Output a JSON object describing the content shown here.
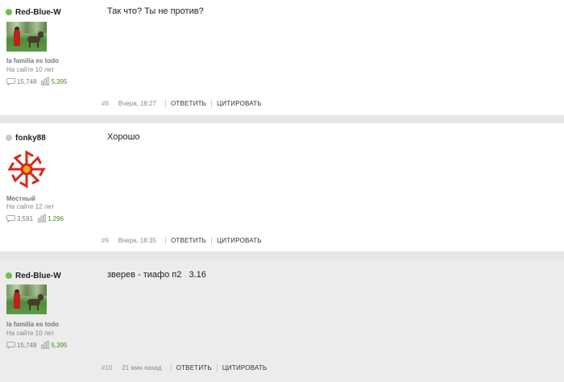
{
  "posts": [
    {
      "author": "Red-Blue-W",
      "online": true,
      "status": "la familia es todo",
      "since": "На сайте 10 лет",
      "post_count": "15,748",
      "reputation": "5,395",
      "message": "Так что? Ты не против?",
      "number": "#8",
      "time": "Вчера, 18:27",
      "reply_label": "ОТВЕТИТЬ",
      "quote_label": "ЦИТИРОВАТЬ"
    },
    {
      "author": "fonky88",
      "online": false,
      "status": "Местный",
      "since": "На сайте 12 лет",
      "post_count": "3,591",
      "reputation": "1,296",
      "message": "Хорошо",
      "number": "#9",
      "time": "Вчера, 18:35",
      "reply_label": "ОТВЕТИТЬ",
      "quote_label": "ЦИТИРОВАТЬ"
    },
    {
      "author": "Red-Blue-W",
      "online": true,
      "status": "la familia es todo",
      "since": "На сайте 10 лет",
      "post_count": "15,748",
      "reputation": "5,395",
      "message": "зверев - тиафо п2   3.16",
      "number": "#10",
      "time": "21 мин назад",
      "reply_label": "ОТВЕТИТЬ",
      "quote_label": "ЦИТИРОВАТЬ"
    }
  ],
  "colors": {
    "online": "#6cc04a",
    "offline": "#c8c8c8",
    "reputation": "#4a8a1e"
  },
  "icons": {
    "posts": "speech-bubble-icon",
    "reputation": "bar-chart-icon"
  }
}
